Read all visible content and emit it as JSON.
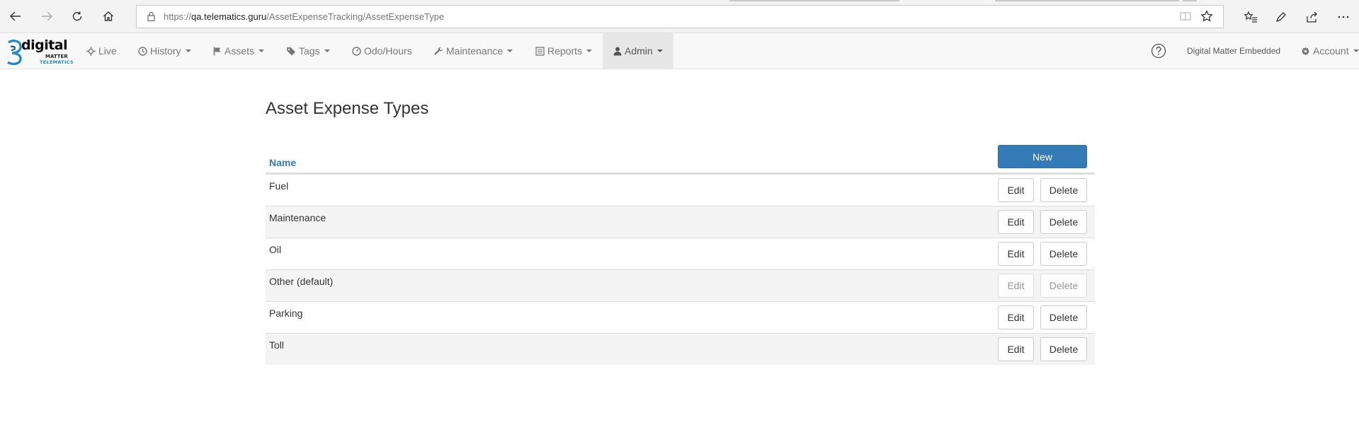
{
  "browser": {
    "url_prefix": "https://",
    "url_host": "qa.telematics.guru",
    "url_path": "/AssetExpenseTracking/AssetExpenseType"
  },
  "navbar": {
    "logo": {
      "word": "digital",
      "matter": "MATTER",
      "tele": "TELEMATICS"
    },
    "items": [
      {
        "label": "Live",
        "icon": "crosshair-icon",
        "dropdown": false
      },
      {
        "label": "History",
        "icon": "clock-icon",
        "dropdown": true
      },
      {
        "label": "Assets",
        "icon": "flag-icon",
        "dropdown": true
      },
      {
        "label": "Tags",
        "icon": "tag-icon",
        "dropdown": true
      },
      {
        "label": "Odo/Hours",
        "icon": "dashboard-icon",
        "dropdown": false
      },
      {
        "label": "Maintenance",
        "icon": "wrench-icon",
        "dropdown": true
      },
      {
        "label": "Reports",
        "icon": "list-icon",
        "dropdown": true
      },
      {
        "label": "Admin",
        "icon": "user-icon",
        "dropdown": true,
        "active": true
      }
    ],
    "org_name": "Digital Matter Embedded",
    "account_label": "Account"
  },
  "page": {
    "title": "Asset Expense Types",
    "new_label": "New",
    "column_name": "Name",
    "edit_label": "Edit",
    "delete_label": "Delete",
    "rows": [
      {
        "name": "Fuel",
        "disabled": false
      },
      {
        "name": "Maintenance",
        "disabled": false
      },
      {
        "name": "Oil",
        "disabled": false
      },
      {
        "name": "Other (default)",
        "disabled": true
      },
      {
        "name": "Parking",
        "disabled": false
      },
      {
        "name": "Toll",
        "disabled": false
      }
    ]
  },
  "colors": {
    "primary": "#337ab7",
    "nav_text": "#777777",
    "nav_active_bg": "#e7e7e7"
  }
}
